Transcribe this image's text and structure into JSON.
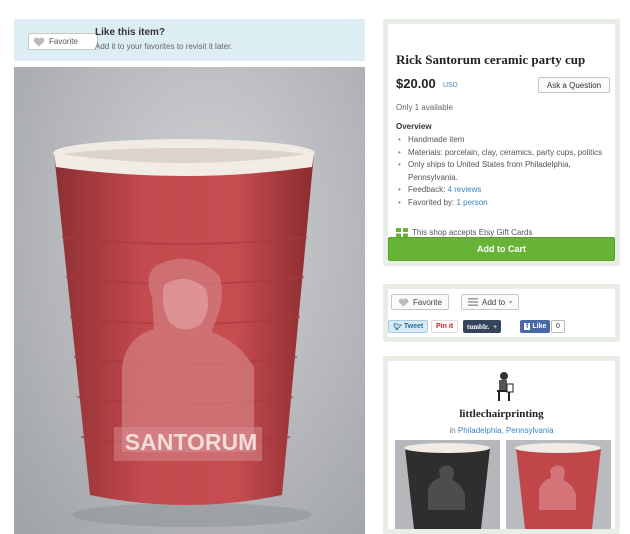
{
  "favorite_banner": {
    "button_label": "Favorite",
    "title": "Like this item?",
    "subtitle": "Add it to your favorites to revisit it later."
  },
  "product_image": {
    "cup_text": "SANTORUM"
  },
  "listing": {
    "title": "Rick Santorum ceramic party cup",
    "price": "$20.00",
    "currency": "USD",
    "ask_button": "Ask a Question",
    "availability": "Only 1 available",
    "overview_heading": "Overview",
    "overview_items": {
      "handmade": "Handmade item",
      "materials": "Materials: porcelain, clay, ceramics, party cups, politics",
      "ships": "Only ships to United States from Philadelphia, Pennsylvania.",
      "feedback_label": "Feedback: ",
      "feedback_link": "4 reviews",
      "favorited_label": "Favorited by: ",
      "favorited_link": "1 person"
    },
    "gift_cards": "This shop accepts Etsy Gift Cards",
    "cart_button": "Add to Cart"
  },
  "social": {
    "favorite_label": "Favorite",
    "add_to_label": "Add to",
    "tweet": "Tweet",
    "pinit": "Pin it",
    "tumblr": "tumblr.",
    "like": "Like",
    "like_count": "0"
  },
  "shop": {
    "name": "littlechairprinting",
    "location_prefix": "in ",
    "location": "Philadelphia, Pennsylvania"
  },
  "colors": {
    "accent": "#67b337",
    "link": "#3b84c3",
    "cup_red": "#c0464a"
  },
  "icons": [
    "heart-icon",
    "list-icon",
    "gift-card-icon",
    "shop-avatar-icon"
  ]
}
